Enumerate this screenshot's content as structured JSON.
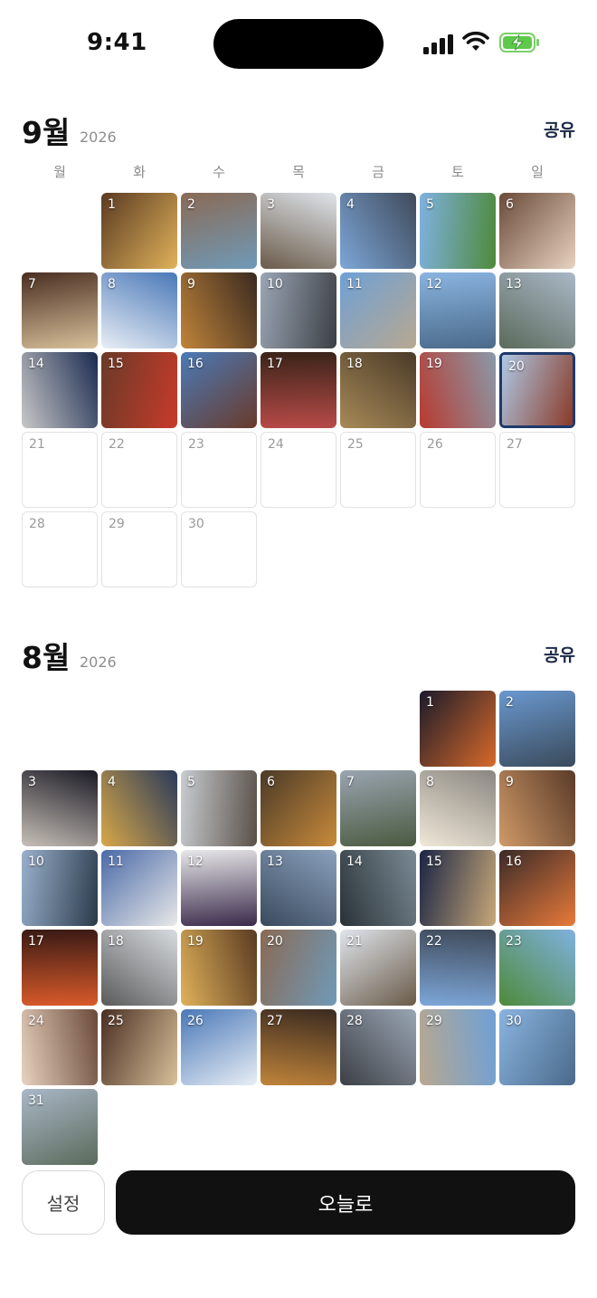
{
  "status_bar": {
    "time": "9:41"
  },
  "weekdays": [
    "월",
    "화",
    "수",
    "목",
    "금",
    "토",
    "일"
  ],
  "months": [
    {
      "title": "9월",
      "year": "2026",
      "share_label": "공유",
      "first_weekday_index": 1,
      "days_in_month": 30,
      "today": 20,
      "photo_days": [
        {
          "day": 1,
          "colors": [
            "#5a3a22",
            "#e0b25a"
          ],
          "icon": "photo-noodles"
        },
        {
          "day": 2,
          "colors": [
            "#8a6a55",
            "#6f9ab8"
          ],
          "icon": "photo-building-tram"
        },
        {
          "day": 3,
          "colors": [
            "#dfe5ec",
            "#6a5a48"
          ],
          "icon": "photo-snowy-mountain"
        },
        {
          "day": 4,
          "colors": [
            "#3f4a5a",
            "#7da6d8"
          ],
          "icon": "photo-buddha"
        },
        {
          "day": 5,
          "colors": [
            "#7fb1e0",
            "#4e8a3a"
          ],
          "icon": "photo-park"
        },
        {
          "day": 6,
          "colors": [
            "#6a4a3a",
            "#e8d2c0"
          ],
          "icon": "photo-cafe-dessert"
        },
        {
          "day": 7,
          "colors": [
            "#4a2e22",
            "#d8c09a"
          ],
          "icon": "photo-dumplings"
        },
        {
          "day": 8,
          "colors": [
            "#4a78b8",
            "#e8eef5"
          ],
          "icon": "photo-sky-beach"
        },
        {
          "day": 9,
          "colors": [
            "#3a2a20",
            "#c0843a"
          ],
          "icon": "photo-curry-bowl"
        },
        {
          "day": 10,
          "colors": [
            "#9aa6b4",
            "#3c3f45"
          ],
          "icon": "photo-tall-building"
        },
        {
          "day": 11,
          "colors": [
            "#6ea0d6",
            "#b8a890"
          ],
          "icon": "photo-beach"
        },
        {
          "day": 12,
          "colors": [
            "#8ab4e0",
            "#4a6a8a"
          ],
          "icon": "photo-lantern"
        },
        {
          "day": 13,
          "colors": [
            "#aab8c8",
            "#5a6a5a"
          ],
          "icon": "photo-cityscape"
        },
        {
          "day": 14,
          "colors": [
            "#1a2a50",
            "#c8c8c8"
          ],
          "icon": "photo-statue-night"
        },
        {
          "day": 15,
          "colors": [
            "#6a3a28",
            "#c83a2a"
          ],
          "icon": "photo-pizza"
        },
        {
          "day": 16,
          "colors": [
            "#4a7ab8",
            "#6a3a2a"
          ],
          "icon": "photo-temple"
        },
        {
          "day": 17,
          "colors": [
            "#3a2418",
            "#b84a48"
          ],
          "icon": "photo-meat-plate"
        },
        {
          "day": 18,
          "colors": [
            "#4a3a28",
            "#a88a58"
          ],
          "icon": "photo-wine-table"
        },
        {
          "day": 19,
          "colors": [
            "#8a9aaa",
            "#b83a30"
          ],
          "icon": "photo-red-tram"
        },
        {
          "day": 20,
          "colors": [
            "#aec8e4",
            "#8a3a28"
          ],
          "icon": "photo-red-brick-building"
        }
      ]
    },
    {
      "title": "8월",
      "year": "2026",
      "share_label": "공유",
      "first_weekday_index": 5,
      "days_in_month": 31,
      "today": null,
      "photo_days": [
        {
          "day": 1,
          "colors": [
            "#1a1a2a",
            "#d86a2a"
          ],
          "icon": "photo-tokyo-tower"
        },
        {
          "day": 2,
          "colors": [
            "#6a98d0",
            "#3a4a5a"
          ],
          "icon": "photo-harbor"
        },
        {
          "day": 3,
          "colors": [
            "#1a1a24",
            "#c8c0b8"
          ],
          "icon": "photo-cathedral-night"
        },
        {
          "day": 4,
          "colors": [
            "#2a3a5a",
            "#d8a848"
          ],
          "icon": "photo-street-dusk"
        },
        {
          "day": 5,
          "colors": [
            "#c8ccd0",
            "#5a5048"
          ],
          "icon": "photo-arcade"
        },
        {
          "day": 6,
          "colors": [
            "#4a3a28",
            "#c88a3a"
          ],
          "icon": "photo-okonomiyaki"
        },
        {
          "day": 7,
          "colors": [
            "#9aa4b0",
            "#4a5a40"
          ],
          "icon": "photo-street-trees"
        },
        {
          "day": 8,
          "colors": [
            "#8a8680",
            "#f0e8d8"
          ],
          "icon": "photo-ice-cream"
        },
        {
          "day": 9,
          "colors": [
            "#5a3a28",
            "#d09a68"
          ],
          "icon": "photo-seafood"
        },
        {
          "day": 10,
          "colors": [
            "#9ab0cc",
            "#2a3a4a"
          ],
          "icon": "photo-mt-fuji"
        },
        {
          "day": 11,
          "colors": [
            "#4a6aa8",
            "#e8e8e8"
          ],
          "icon": "photo-statues"
        },
        {
          "day": 12,
          "colors": [
            "#e8e8ea",
            "#3a2a4a"
          ],
          "icon": "photo-snack"
        },
        {
          "day": 13,
          "colors": [
            "#8aa0bc",
            "#3a4a5e"
          ],
          "icon": "photo-lake"
        },
        {
          "day": 14,
          "colors": [
            "#7a8a94",
            "#2a3238"
          ],
          "icon": "photo-water"
        },
        {
          "day": 15,
          "colors": [
            "#1a2444",
            "#c8a878"
          ],
          "icon": "photo-night-view"
        },
        {
          "day": 16,
          "colors": [
            "#3a2a28",
            "#e87a3a"
          ],
          "icon": "photo-sushi"
        },
        {
          "day": 17,
          "colors": [
            "#3a1a14",
            "#d85a2a"
          ],
          "icon": "photo-shrine-night"
        },
        {
          "day": 18,
          "colors": [
            "#d8dce0",
            "#5a5a5a"
          ],
          "icon": "photo-white-gate"
        },
        {
          "day": 19,
          "colors": [
            "#5a3a22",
            "#e0b25a"
          ],
          "icon": "photo-noodles"
        },
        {
          "day": 20,
          "colors": [
            "#8a6a55",
            "#6f9ab8"
          ],
          "icon": "photo-building-tram"
        },
        {
          "day": 21,
          "colors": [
            "#dfe5ec",
            "#6a5a48"
          ],
          "icon": "photo-snowy-mountain"
        },
        {
          "day": 22,
          "colors": [
            "#3f4a5a",
            "#7da6d8"
          ],
          "icon": "photo-buddha"
        },
        {
          "day": 23,
          "colors": [
            "#7fb1e0",
            "#4e8a3a"
          ],
          "icon": "photo-park"
        },
        {
          "day": 24,
          "colors": [
            "#6a4a3a",
            "#e8d2c0"
          ],
          "icon": "photo-cafe-dessert"
        },
        {
          "day": 25,
          "colors": [
            "#4a2e22",
            "#d8c09a"
          ],
          "icon": "photo-dumplings"
        },
        {
          "day": 26,
          "colors": [
            "#4a78b8",
            "#e8eef5"
          ],
          "icon": "photo-sky-beach"
        },
        {
          "day": 27,
          "colors": [
            "#3a2a20",
            "#c0843a"
          ],
          "icon": "photo-curry-bowl"
        },
        {
          "day": 28,
          "colors": [
            "#9aa6b4",
            "#3c3f45"
          ],
          "icon": "photo-tall-building"
        },
        {
          "day": 29,
          "colors": [
            "#6ea0d6",
            "#b8a890"
          ],
          "icon": "photo-beach"
        },
        {
          "day": 30,
          "colors": [
            "#8ab4e0",
            "#4a6a8a"
          ],
          "icon": "photo-lantern"
        },
        {
          "day": 31,
          "colors": [
            "#aab8c8",
            "#5a6a5a"
          ],
          "icon": "photo-cityscape"
        }
      ]
    }
  ],
  "bottom_bar": {
    "settings_label": "설정",
    "today_label": "오늘로"
  },
  "colors": {
    "accent_dark": "#111111",
    "today_border": "#1e3a6b",
    "share_text": "#1c2a46",
    "empty_border": "#e2e2e2"
  }
}
